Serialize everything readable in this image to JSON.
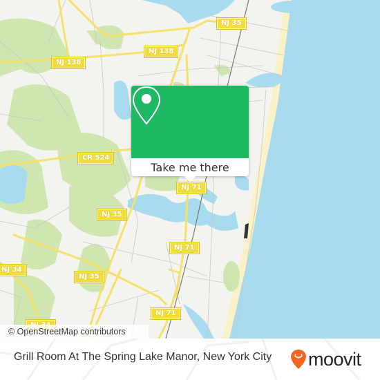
{
  "map": {
    "road_labels": [
      {
        "id": "nj35-top",
        "text": "NJ 35"
      },
      {
        "id": "nj138-mid",
        "text": "NJ 138"
      },
      {
        "id": "nj138-left",
        "text": "NJ 138"
      },
      {
        "id": "cr524",
        "text": "CR 524"
      },
      {
        "id": "nj71-top",
        "text": "NJ 71"
      },
      {
        "id": "nj35-left",
        "text": "NJ 35"
      },
      {
        "id": "nj71-mid",
        "text": "NJ 71"
      },
      {
        "id": "nj34-left",
        "text": "NJ 34"
      },
      {
        "id": "nj35-bottom",
        "text": "NJ 35"
      },
      {
        "id": "nj71-bottom",
        "text": "NJ 71"
      },
      {
        "id": "nj34-bottom",
        "text": "NJ 34"
      }
    ],
    "attribution": "© OpenStreetMap contributors"
  },
  "popup": {
    "icon": "map-pin-icon",
    "button_label": "Take me there",
    "color": "#1fb864"
  },
  "footer": {
    "title": "Grill Room At The Spring Lake Manor, New York City",
    "logo_text": "moovit",
    "logo_icon": "moovit-pin-smile-icon",
    "brand_color": "#f26522"
  },
  "colors": {
    "water": "#a8dbee",
    "land": "#f3f3ef",
    "park": "#cfe6b0",
    "road_major": "#f5e16a",
    "beach": "#fbf1c8"
  }
}
